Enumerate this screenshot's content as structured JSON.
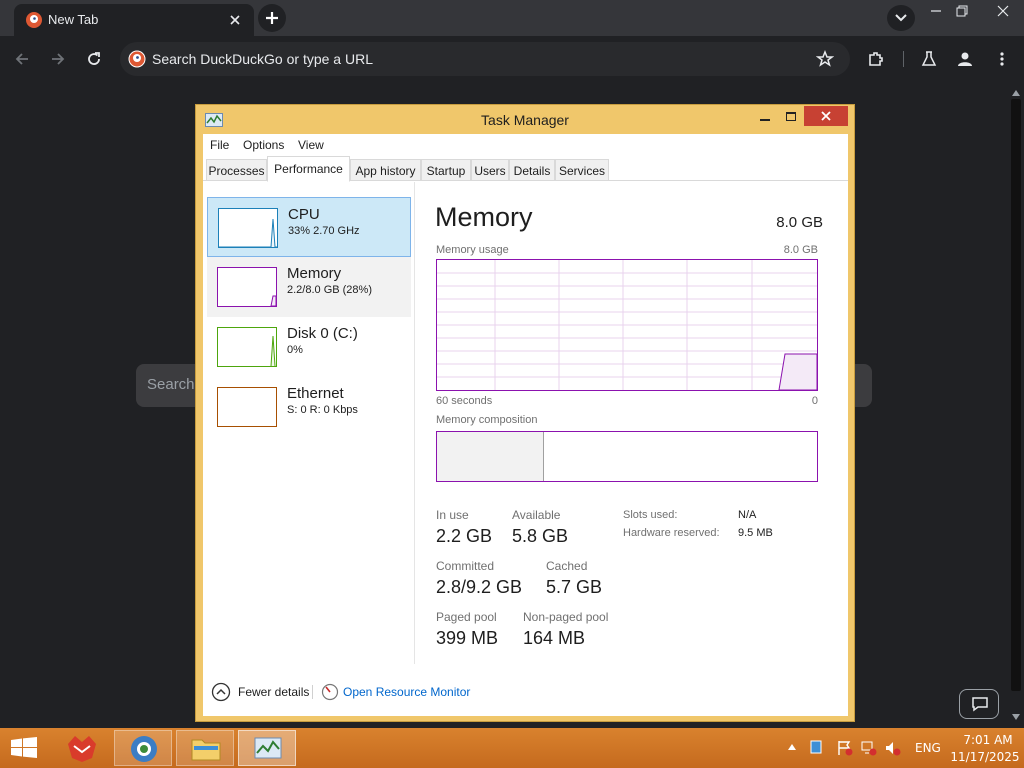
{
  "browser": {
    "tab_title": "New Tab",
    "omnibox_placeholder": "Search DuckDuckGo or type a URL",
    "page_search_placeholder": "Search"
  },
  "task_manager": {
    "title": "Task Manager",
    "menu": [
      "File",
      "Options",
      "View"
    ],
    "tabs": [
      "Processes",
      "Performance",
      "App history",
      "Startup",
      "Users",
      "Details",
      "Services"
    ],
    "active_tab": "Performance",
    "resources": [
      {
        "name": "CPU",
        "detail": "33% 2.70 GHz",
        "color": "#1c80b8"
      },
      {
        "name": "Memory",
        "detail": "2.2/8.0 GB (28%)",
        "color": "#8b12ae"
      },
      {
        "name": "Disk 0 (C:)",
        "detail": "0%",
        "color": "#4da60c"
      },
      {
        "name": "Ethernet",
        "detail": "S: 0 R: 0 Kbps",
        "color": "#a74f01"
      }
    ],
    "memory": {
      "title": "Memory",
      "total": "8.0 GB",
      "usage_label": "Memory usage",
      "usage_max": "8.0 GB",
      "axis_left": "60 seconds",
      "axis_right": "0",
      "composition_label": "Memory composition",
      "stats": {
        "in_use": {
          "label": "In use",
          "value": "2.2 GB"
        },
        "available": {
          "label": "Available",
          "value": "5.8 GB"
        },
        "committed": {
          "label": "Committed",
          "value": "2.8/9.2 GB"
        },
        "cached": {
          "label": "Cached",
          "value": "5.7 GB"
        },
        "paged_pool": {
          "label": "Paged pool",
          "value": "399 MB"
        },
        "non_paged_pool": {
          "label": "Non-paged pool",
          "value": "164 MB"
        }
      },
      "slots_used": {
        "label": "Slots used:",
        "value": "N/A"
      },
      "hardware_reserved": {
        "label": "Hardware reserved:",
        "value": "9.5 MB"
      }
    },
    "footer": {
      "fewer_details": "Fewer details",
      "open_resource_monitor": "Open Resource Monitor"
    }
  },
  "taskbar": {
    "language": "ENG",
    "time": "7:01 AM",
    "date": "11/17/2025"
  },
  "colors": {
    "window_frame": "#f0c76b",
    "close_button": "#c74133",
    "memory_accent": "#8b12ae",
    "taskbar": "#d9822e"
  }
}
